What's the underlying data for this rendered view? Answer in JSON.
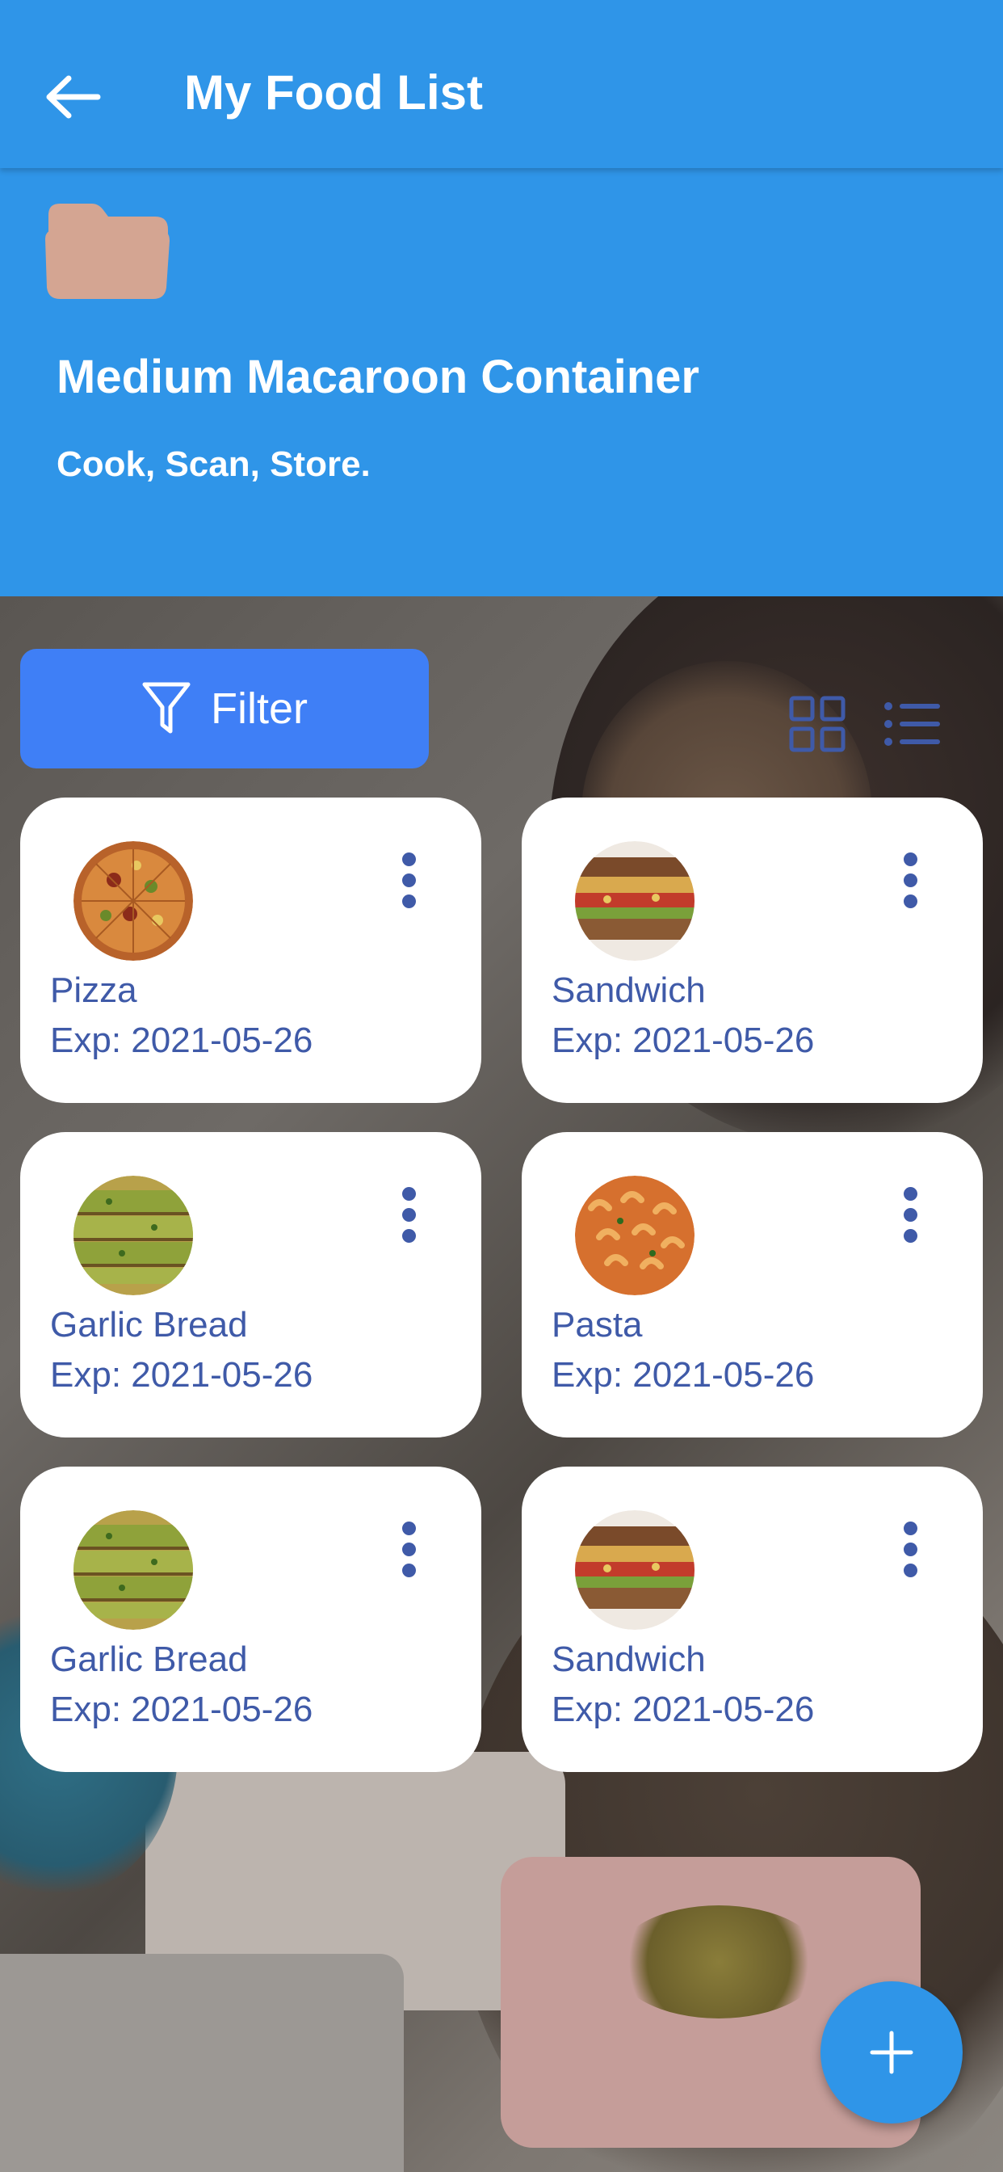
{
  "appbar": {
    "title": "My Food List",
    "back_icon": "arrow-left-icon"
  },
  "header": {
    "folder_icon": "folder-icon",
    "title": "Medium Macaroon Container",
    "subtitle": "Cook, Scan, Store."
  },
  "toolbar": {
    "filter_label": "Filter",
    "filter_icon": "filter-funnel-icon",
    "grid_icon": "grid-view-icon",
    "list_icon": "list-view-icon"
  },
  "items": [
    {
      "name": "Pizza",
      "exp": "Exp: 2021-05-26"
    },
    {
      "name": "Sandwich",
      "exp": "Exp: 2021-05-26"
    },
    {
      "name": "Garlic Bread",
      "exp": "Exp: 2021-05-26"
    },
    {
      "name": "Pasta",
      "exp": "Exp: 2021-05-26"
    },
    {
      "name": "Garlic Bread",
      "exp": "Exp: 2021-05-26"
    },
    {
      "name": "Sandwich",
      "exp": "Exp: 2021-05-26"
    }
  ],
  "fab": {
    "icon": "plus-icon"
  },
  "colors": {
    "primary": "#2f95e8",
    "filter_button": "#3f7ff6",
    "card_text": "#3f5aa8",
    "folder": "#d4a592"
  }
}
